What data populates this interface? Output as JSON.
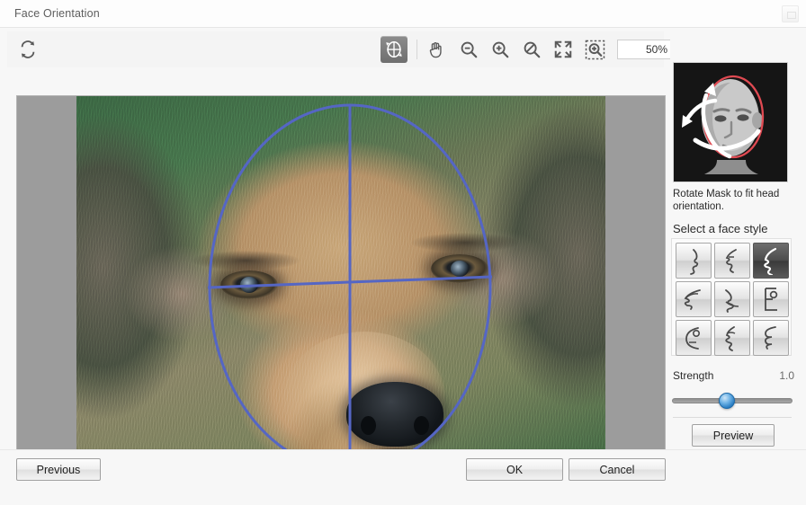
{
  "window": {
    "title": "Face Orientation",
    "close_button_icon": "window-restore-icon"
  },
  "toolbar": {
    "reset_icon": "rotate-refresh-icon",
    "tools": [
      {
        "name": "face-mask-tool",
        "icon": "face-mask-icon",
        "selected": true
      },
      {
        "name": "pan-tool",
        "icon": "hand-icon",
        "selected": false
      },
      {
        "name": "zoom-out-tool",
        "icon": "magnifier-minus-icon",
        "selected": false
      },
      {
        "name": "zoom-in-tool",
        "icon": "magnifier-plus-icon",
        "selected": false
      },
      {
        "name": "zoom-reset-tool",
        "icon": "magnifier-slash-icon",
        "selected": false
      },
      {
        "name": "fit-to-screen-tool",
        "icon": "expand-arrows-icon",
        "selected": false
      },
      {
        "name": "zoom-to-selection-tool",
        "icon": "marquee-zoom-icon",
        "selected": false
      }
    ],
    "zoom_value": "50%"
  },
  "canvas": {
    "background_color": "#9c9c9c",
    "mask_color": "#5566c4",
    "subject": "dog-photo"
  },
  "side_panel": {
    "illustration_name": "head-rotation-illustration",
    "caption": "Rotate Mask to fit head orientation.",
    "subtitle": "Select a face style",
    "face_styles": [
      {
        "id": 1,
        "name": "face-style-1",
        "selected": false
      },
      {
        "id": 2,
        "name": "face-style-2",
        "selected": false
      },
      {
        "id": 3,
        "name": "face-style-3",
        "selected": true
      },
      {
        "id": 4,
        "name": "face-style-4",
        "selected": false
      },
      {
        "id": 5,
        "name": "face-style-5",
        "selected": false
      },
      {
        "id": 6,
        "name": "face-style-6",
        "selected": false
      },
      {
        "id": 7,
        "name": "face-style-7",
        "selected": false
      },
      {
        "id": 8,
        "name": "face-style-8",
        "selected": false
      },
      {
        "id": 9,
        "name": "face-style-9",
        "selected": false
      }
    ],
    "strength_label": "Strength",
    "strength_value": "1.0",
    "strength_percent": 45,
    "preview_label": "Preview"
  },
  "footer": {
    "previous_label": "Previous",
    "ok_label": "OK",
    "cancel_label": "Cancel"
  }
}
